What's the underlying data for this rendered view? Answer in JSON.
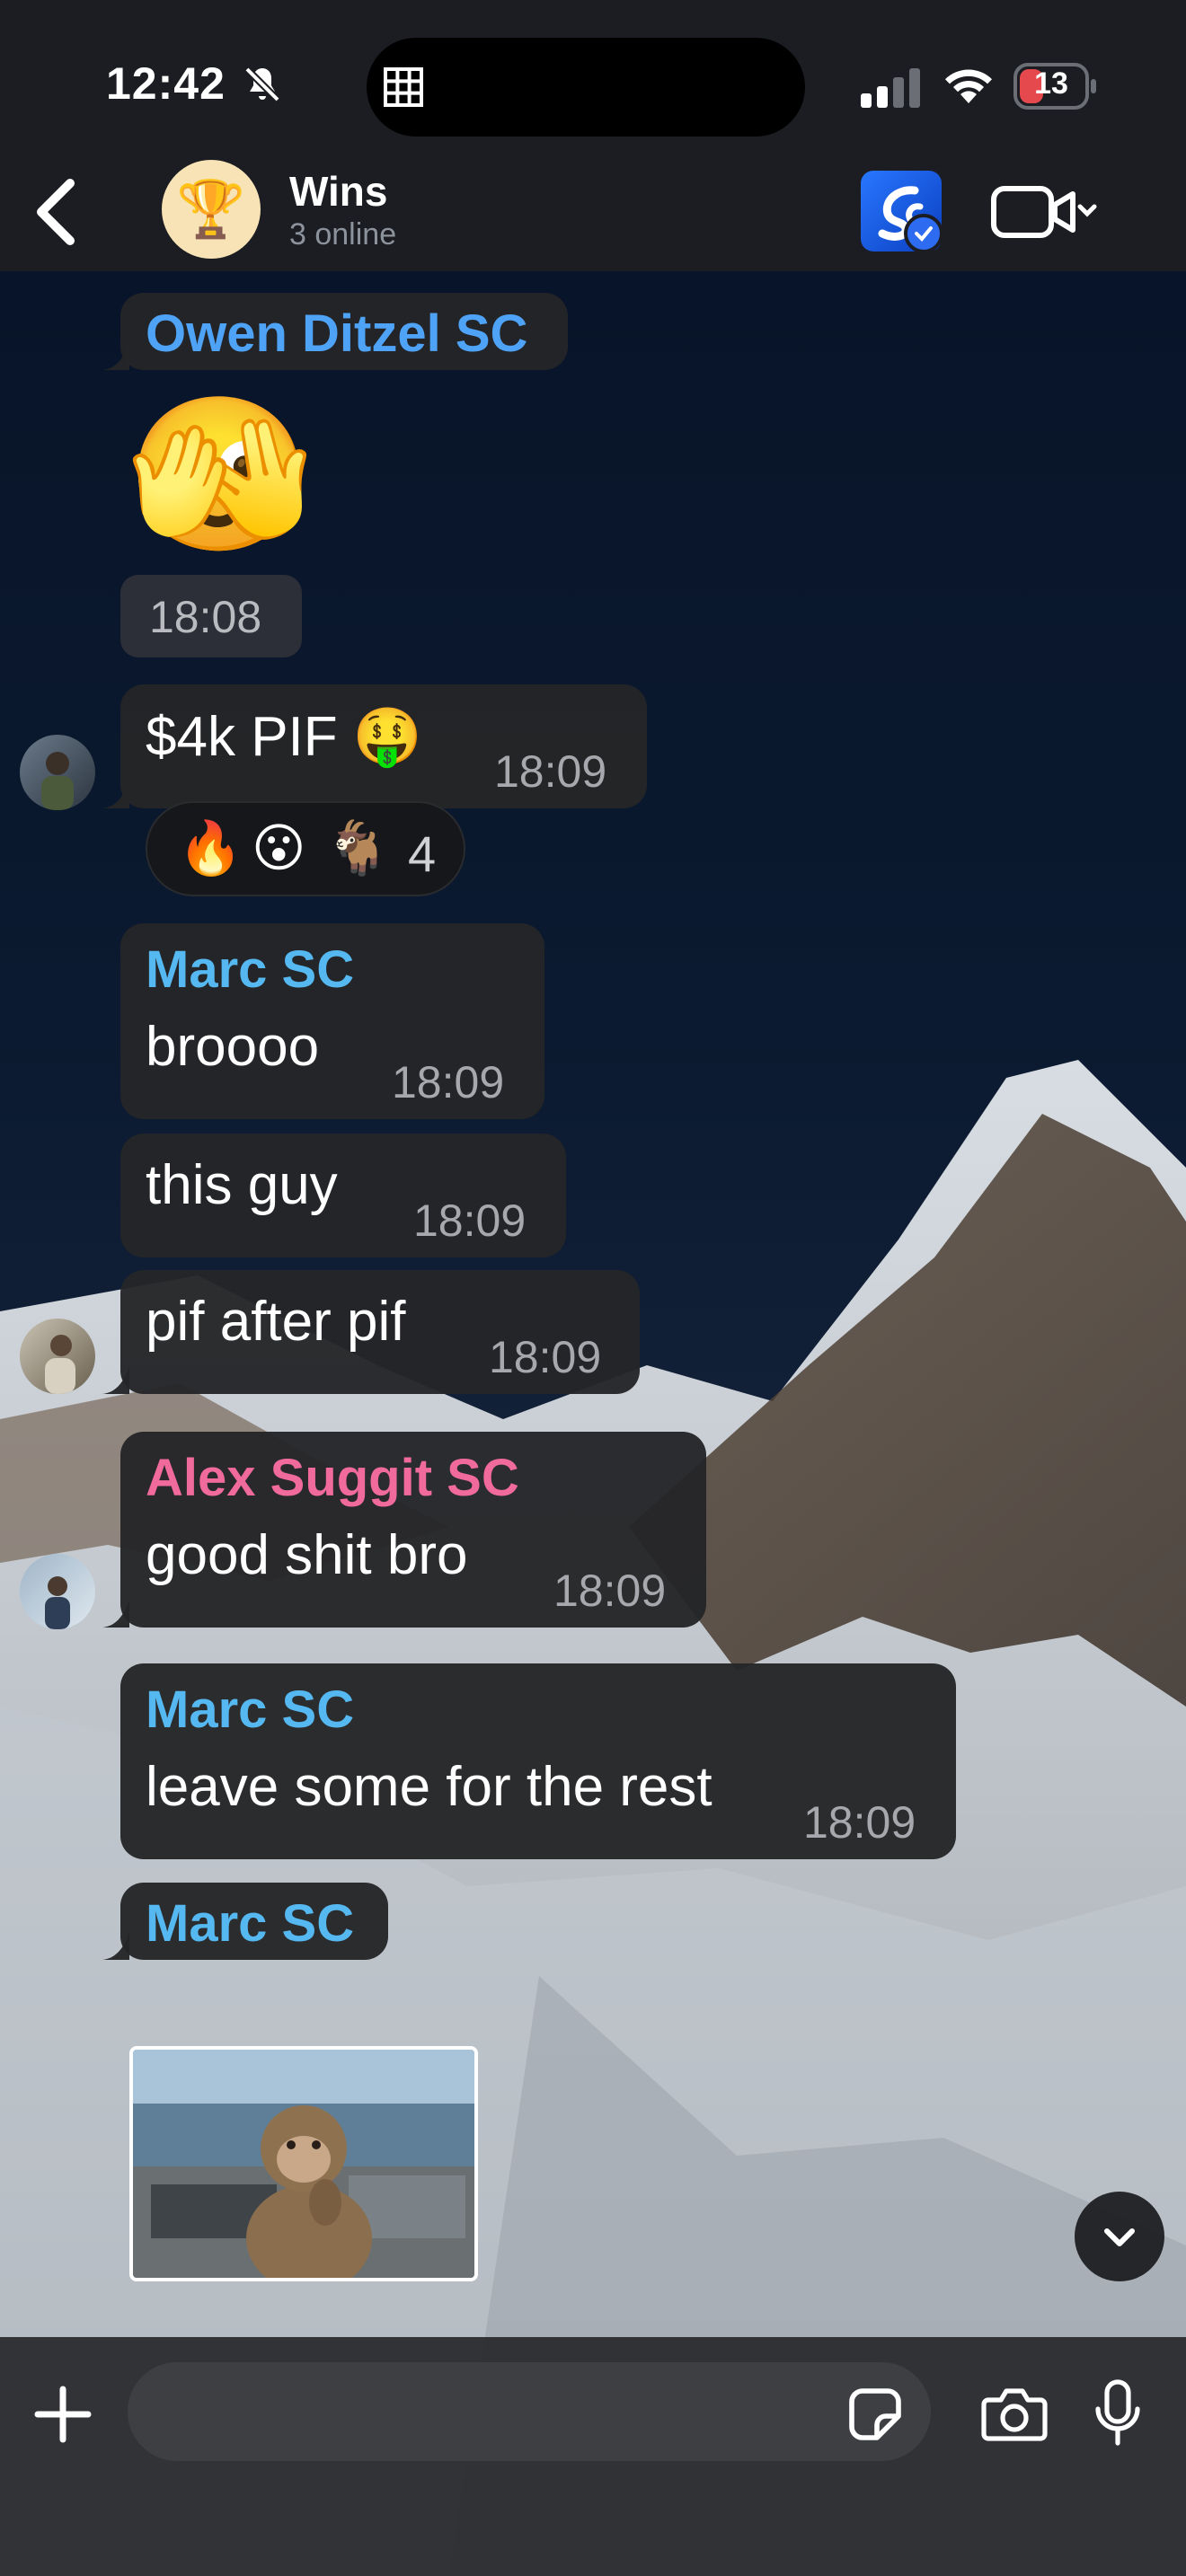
{
  "status_bar": {
    "time": "12:42",
    "battery": "13",
    "colors": {
      "battery_fill": "#e5484d"
    },
    "icons": [
      "bell-slash-icon",
      "grid-icon",
      "cellular-signal-icon",
      "wifi-icon",
      "battery-icon"
    ]
  },
  "header": {
    "title": "Wins",
    "subtitle": "3 online",
    "avatar_emoji": "🏆",
    "icons": [
      "back-chevron-icon",
      "app-badge-icon",
      "video-call-icon",
      "chevron-down-icon"
    ]
  },
  "messages": {
    "m1": {
      "sender": "Owen Ditzel SC",
      "sender_color": "#4fa3f7",
      "emoji": "🫣",
      "time": "18:08"
    },
    "m2": {
      "text": "$4k PIF 🤑",
      "time": "18:09"
    },
    "reactions": {
      "items": [
        "🔥",
        "😮",
        "🐐"
      ],
      "count": "4"
    },
    "m3": {
      "sender": "Marc SC",
      "sender_color": "#56b8f0",
      "text": "broooo",
      "time": "18:09"
    },
    "m4": {
      "text": "this guy",
      "time": "18:09"
    },
    "m5": {
      "text": "pif after pif",
      "time": "18:09"
    },
    "m6": {
      "sender": "Alex Suggit SC",
      "sender_color": "#f06a9b",
      "text": "good shit bro",
      "time": "18:09"
    },
    "m7": {
      "sender": "Marc SC",
      "text": "leave some for the rest",
      "time": "18:09"
    },
    "m8": {
      "sender": "Marc SC"
    }
  },
  "composer": {
    "placeholder": "",
    "icons": [
      "plus-icon",
      "sticker-icon",
      "camera-icon",
      "microphone-icon",
      "scroll-down-icon"
    ]
  }
}
